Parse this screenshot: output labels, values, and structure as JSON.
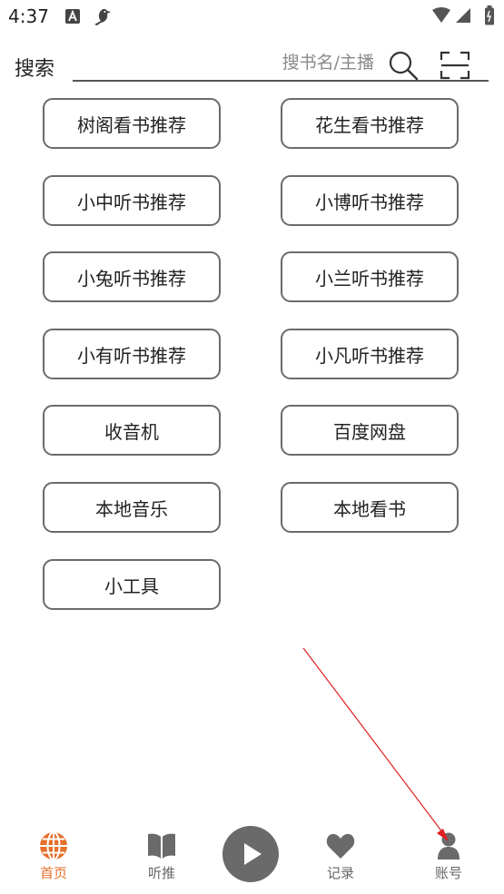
{
  "status_bar": {
    "time": "4:37"
  },
  "search": {
    "label": "搜索",
    "placeholder": "搜书名/主播",
    "search_icon": "search-icon",
    "scan_icon": "scan-icon"
  },
  "main": {
    "buttons": [
      "树阁看书推荐",
      "花生看书推荐",
      "小中听书推荐",
      "小博听书推荐",
      "小兔听书推荐",
      "小兰听书推荐",
      "小有听书推荐",
      "小凡听书推荐",
      "收音机",
      "百度网盘",
      "本地音乐",
      "本地看书",
      "小工具"
    ]
  },
  "bottom_nav": {
    "items": [
      {
        "label": "首页",
        "icon": "globe-icon",
        "active": true
      },
      {
        "label": "听推",
        "icon": "book-icon",
        "active": false
      },
      {
        "label": "",
        "icon": "play-icon",
        "active": false
      },
      {
        "label": "记录",
        "icon": "heart-icon",
        "active": false
      },
      {
        "label": "账号",
        "icon": "person-icon",
        "active": false
      }
    ]
  },
  "colors": {
    "accent": "#e6702c",
    "nav_inactive": "#666666",
    "button_border": "#6b6b6b",
    "annotation_arrow": "#e02020"
  }
}
